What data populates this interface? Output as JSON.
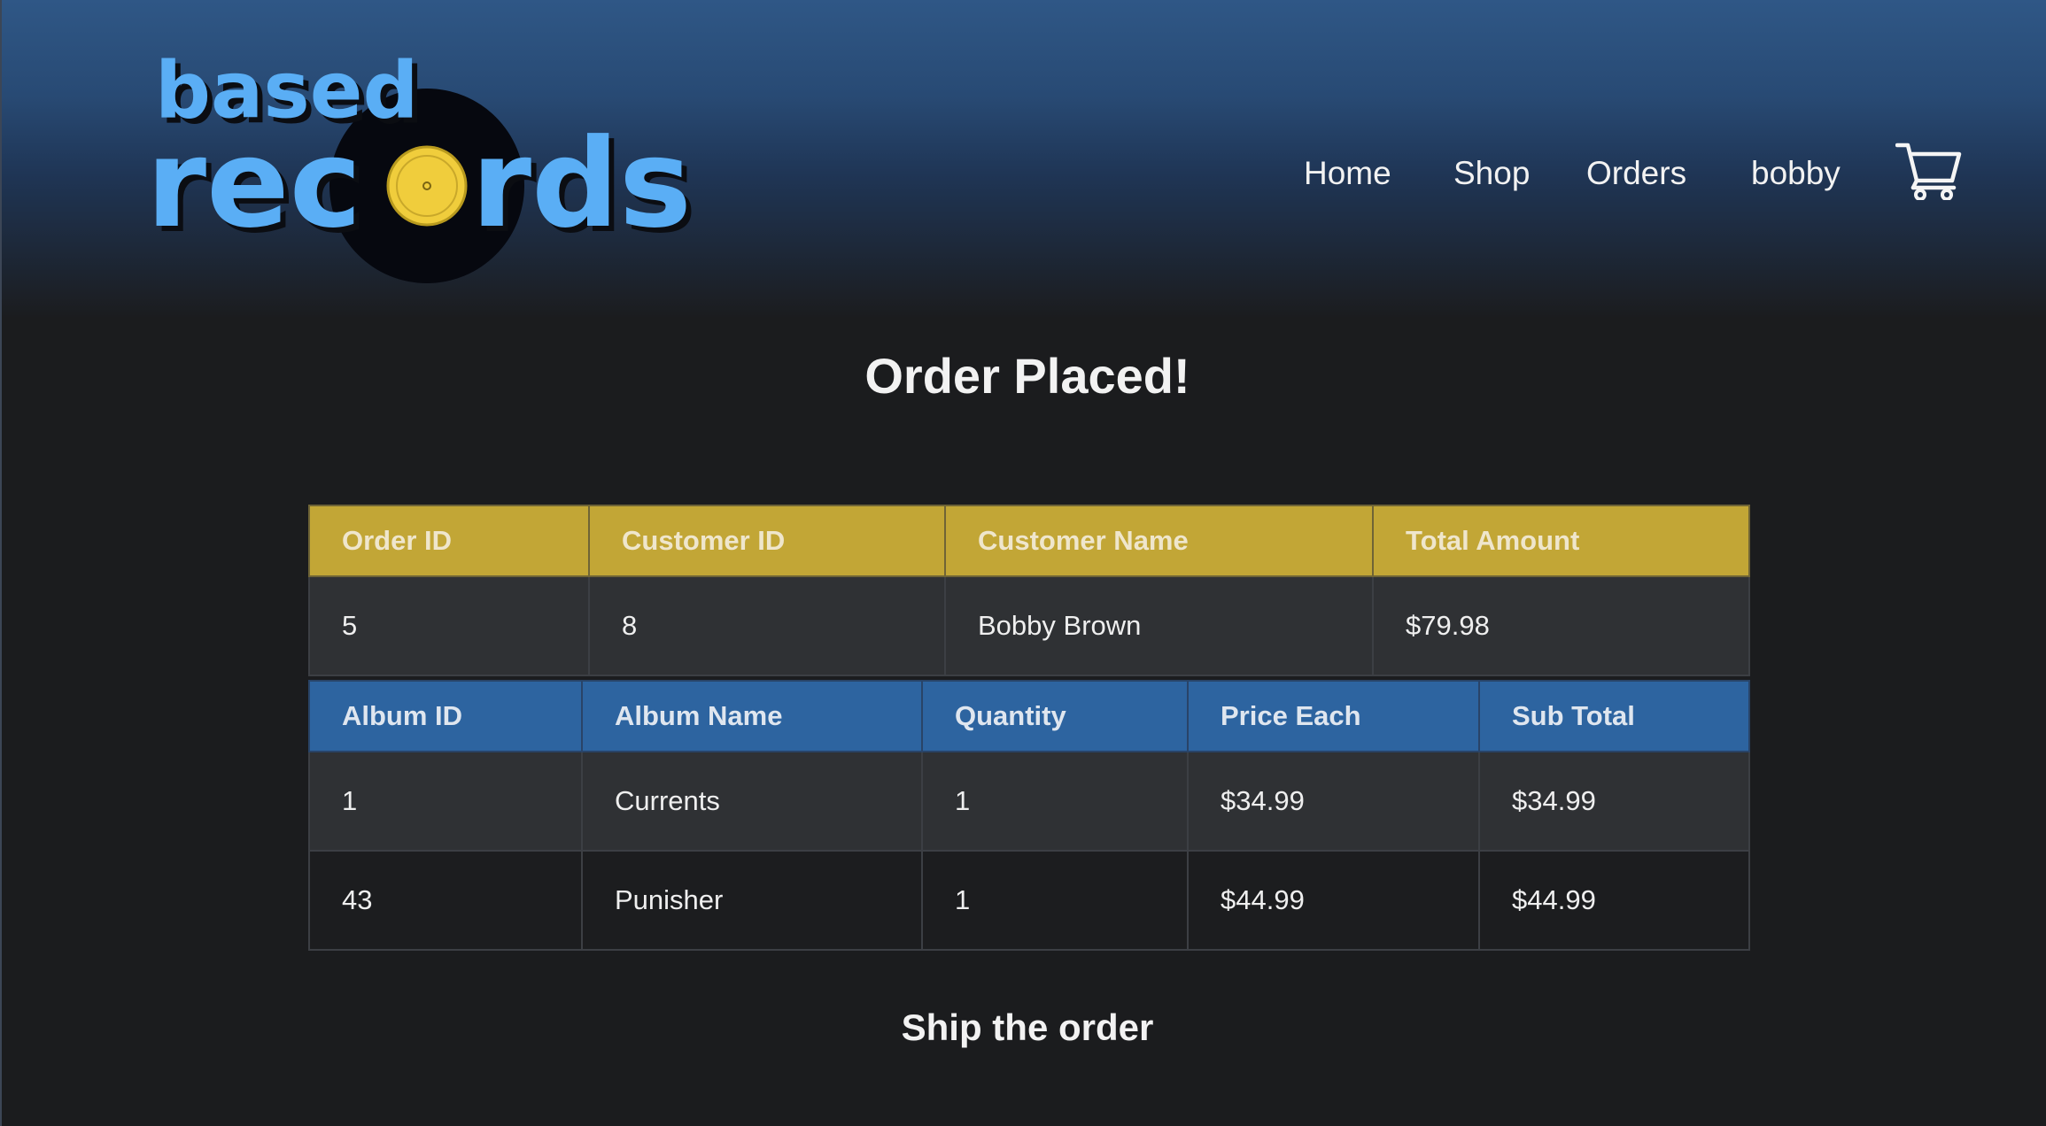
{
  "brand": {
    "line1": "based",
    "line2_start": "rec",
    "line2_end": "rds",
    "colors": {
      "logo_blue": "#5aaef5",
      "vinyl": "#06080f",
      "label_yellow": "#f0cd3c"
    }
  },
  "nav": {
    "home": "Home",
    "shop": "Shop",
    "orders": "Orders",
    "user": "bobby",
    "cart_icon": "cart-icon"
  },
  "page": {
    "title": "Order Placed!",
    "ship_link": "Ship the order"
  },
  "order_table": {
    "headers": [
      "Order ID",
      "Customer ID",
      "Customer Name",
      "Total Amount"
    ],
    "row": [
      "5",
      "8",
      "Bobby Brown",
      "$79.98"
    ],
    "header_color": "#c2a636"
  },
  "items_table": {
    "headers": [
      "Album ID",
      "Album Name",
      "Quantity",
      "Price Each",
      "Sub Total"
    ],
    "rows": [
      [
        "1",
        "Currents",
        "1",
        "$34.99",
        "$34.99"
      ],
      [
        "43",
        "Punisher",
        "1",
        "$44.99",
        "$44.99"
      ]
    ],
    "header_color": "#2d64a0"
  }
}
